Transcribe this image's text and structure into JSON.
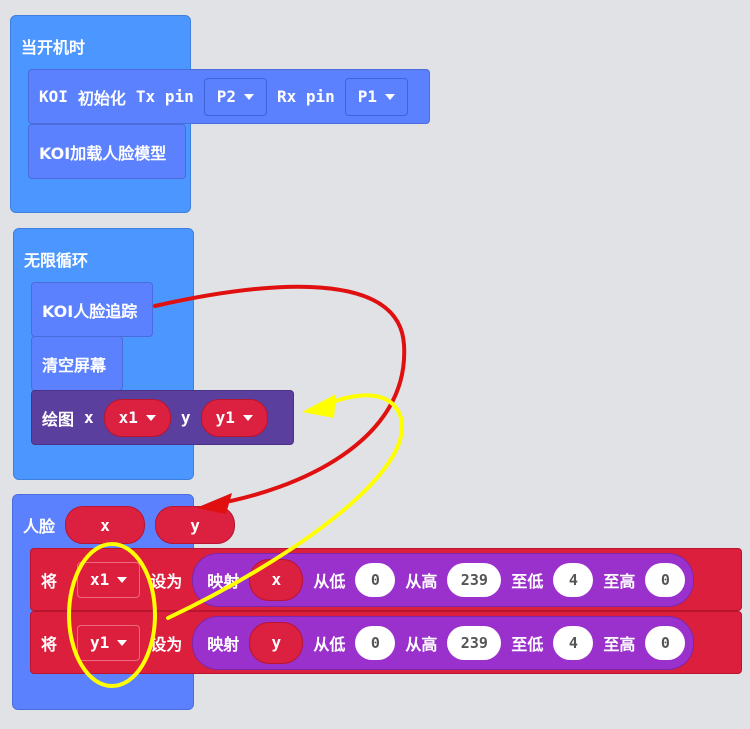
{
  "on_start": {
    "label": "当开机时",
    "init": {
      "prefix": "KOI",
      "word": "初始化",
      "tx": "Tx pin",
      "tx_val": "P2",
      "rx": "Rx pin",
      "rx_val": "P1"
    },
    "load_model": "KOI加载人脸模型"
  },
  "forever": {
    "label": "无限循环",
    "track": "KOI人脸追踪",
    "clear": "清空屏幕",
    "draw": {
      "label": "绘图",
      "x_label": "x",
      "x_var": "x1",
      "y_label": "y",
      "y_var": "y1"
    }
  },
  "face": {
    "label": "人脸",
    "x": "x",
    "y": "y",
    "sets": [
      {
        "set": "将",
        "var": "x1",
        "to": "设为",
        "map": "映射",
        "src": "x",
        "from_low": "从低",
        "from_low_val": "0",
        "from_high": "从高",
        "from_high_val": "239",
        "to_low": "至低",
        "to_low_val": "4",
        "to_high": "至高",
        "to_high_val": "0"
      },
      {
        "set": "将",
        "var": "y1",
        "to": "设为",
        "map": "映射",
        "src": "y",
        "from_low": "从低",
        "from_low_val": "0",
        "from_high": "从高",
        "from_high_val": "239",
        "to_low": "至低",
        "to_low_val": "4",
        "to_high": "至高",
        "to_high_val": "0"
      }
    ]
  },
  "colors": {
    "hat": "#4c97ff",
    "koi": "#5c81ff",
    "draw": "#5b3f9e",
    "variables": "#dc1f3c",
    "math": "#9b31cc",
    "annotation_red": "#e01010",
    "annotation_yellow": "#ffff00"
  }
}
